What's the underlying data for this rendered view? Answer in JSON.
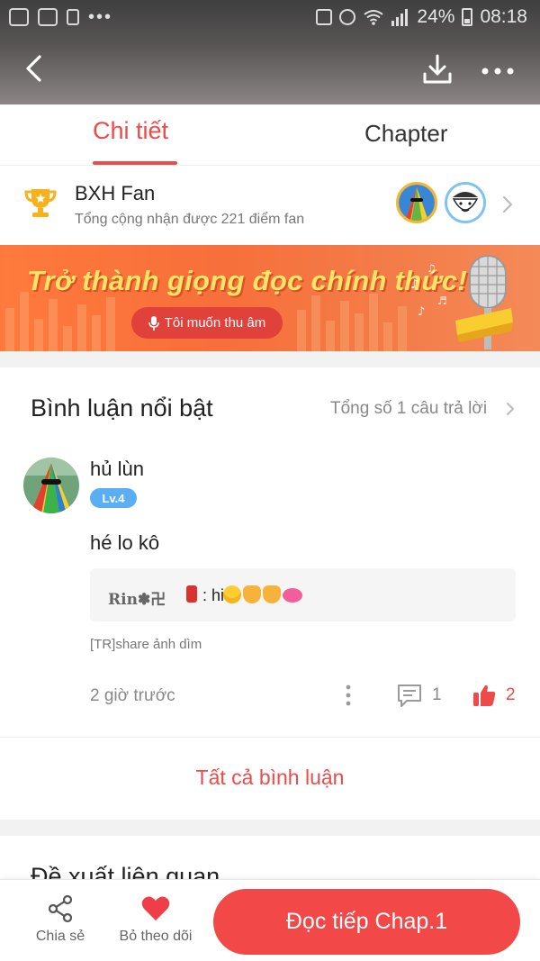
{
  "status_bar": {
    "battery": "24%",
    "time": "08:18"
  },
  "tabs": [
    {
      "label": "Chi tiết",
      "active": true
    },
    {
      "label": "Chapter",
      "active": false
    }
  ],
  "fan_ranking": {
    "title": "BXH Fan",
    "subtitle": "Tổng cộng nhận được 221 điểm fan",
    "icons": [
      "trophy-icon",
      "fan-avatar",
      "fan-avatar"
    ]
  },
  "banner": {
    "title": "Trở thành giọng đọc chính thức!",
    "button_label": "Tôi muốn thu âm"
  },
  "comments": {
    "section_title": "Bình luận nổi bật",
    "total_replies": "Tổng số 1 câu trả lời",
    "comment": {
      "username": "hủ lùn",
      "level": "Lv.4",
      "text": "hé lo kô",
      "reply": {
        "name": "Rin✽卍",
        "text": ": hi"
      },
      "source": "[TR]share ảnh dìm",
      "time": "2 giờ trước",
      "reply_count": "1",
      "like_count": "2"
    },
    "all_comments_label": "Tất cả bình luận"
  },
  "related": {
    "section_title": "Đề xuất liên quan"
  },
  "bottom_bar": {
    "share_label": "Chia sẻ",
    "unfollow_label": "Bỏ theo dõi",
    "read_button_label": "Đọc tiếp Chap.1"
  },
  "colors": {
    "accent": "#ef4a4a",
    "level_badge": "#5aaef2",
    "banner_orange": "#f76f3a",
    "banner_text": "#ffe466"
  }
}
